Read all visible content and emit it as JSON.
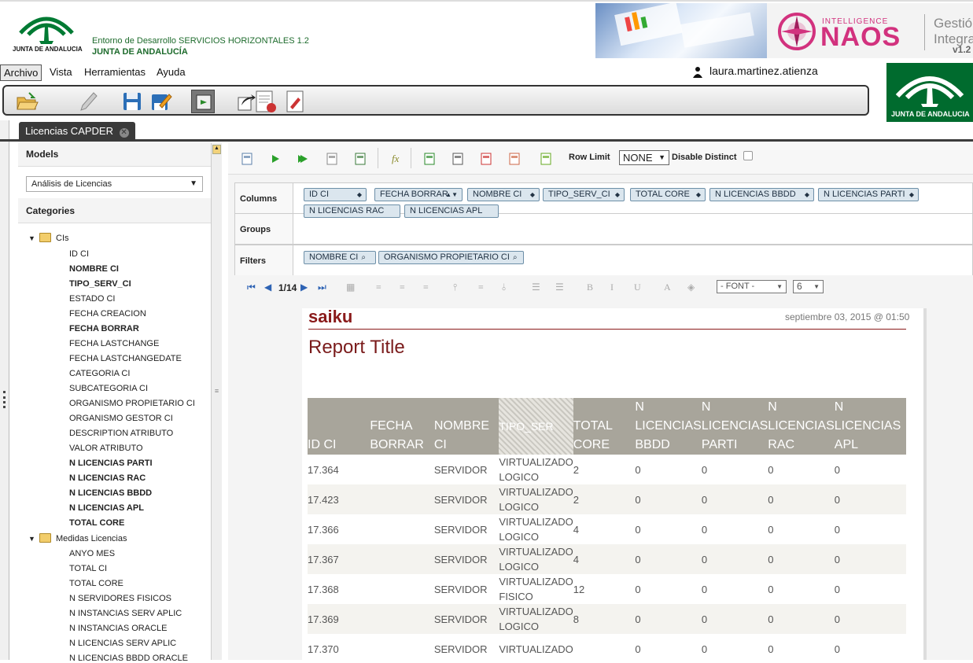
{
  "header": {
    "logo_text": "JUNTA DE ANDALUCIA",
    "env_title": "Entorno de Desarrollo SERVICIOS HORIZONTALES 1.2",
    "org_title": "JUNTA DE ANDALUCÍA",
    "naos_small": "INTELLIGENCE",
    "naos_big": "NAOS",
    "naos_right1": "Gestió",
    "naos_right2": "Integra",
    "naos_version": "v1.2"
  },
  "menu": {
    "archivo": "Archivo",
    "vista": "Vista",
    "herramientas": "Herramientas",
    "ayuda": "Ayuda"
  },
  "user": "laura.martinez.atienza",
  "right_logo_text": "JUNTA DE ANDALUCIA",
  "tab": {
    "label": "Licencias CAPDER"
  },
  "sidebar": {
    "models_title": "Models",
    "model_selected": "Análisis de Licencias",
    "categories_title": "Categories",
    "tree": {
      "group1": "CIs",
      "group1_items": [
        "ID CI",
        "NOMBRE CI",
        "TIPO_SERV_CI",
        "ESTADO CI",
        "FECHA CREACION",
        "FECHA BORRAR",
        "FECHA LASTCHANGE",
        "FECHA LASTCHANGEDATE",
        "CATEGORIA CI",
        "SUBCATEGORIA CI",
        "ORGANISMO PROPIETARIO CI",
        "ORGANISMO GESTOR CI",
        "DESCRIPTION ATRIBUTO",
        "VALOR ATRIBUTO",
        "N LICENCIAS PARTI",
        "N LICENCIAS RAC",
        "N LICENCIAS BBDD",
        "N LICENCIAS APL",
        "TOTAL CORE"
      ],
      "group2": "Medidas Licencias",
      "group2_items": [
        "ANYO MES",
        "TOTAL CI",
        "TOTAL CORE",
        "N SERVIDORES FISICOS",
        "N INSTANCIAS SERV APLIC",
        "N INSTANCIAS ORACLE",
        "N LICENCIAS SERV APLIC",
        "N LICENCIAS BBDD ORACLE"
      ]
    }
  },
  "query_toolbar": {
    "row_limit_label": "Row Limit",
    "row_limit_value": "NONE",
    "disable_distinct": "Disable Distinct"
  },
  "axes": {
    "columns_label": "Columns",
    "columns": [
      "ID CI",
      "FECHA BORRAR",
      "NOMBRE CI",
      "TIPO_SERV_CI",
      "TOTAL CORE",
      "N LICENCIAS BBDD",
      "N LICENCIAS PARTI",
      "N LICENCIAS RAC",
      "N LICENCIAS APL"
    ],
    "groups_label": "Groups",
    "filters_label": "Filters",
    "filters": [
      "NOMBRE CI",
      "ORGANISMO PROPIETARIO CI"
    ]
  },
  "pager": {
    "page": "1/14",
    "font_select": "- FONT -",
    "size_select": "6"
  },
  "report": {
    "logo": "saiku",
    "date": "septiembre 03, 2015 @ 01:50",
    "title": "Report Title",
    "headers": [
      "ID CI",
      "FECHA BORRAR",
      "NOMBRE CI",
      "TIPO_SER",
      "TOTAL CORE",
      "N LICENCIAS BBDD",
      "N LICENCIAS PARTI",
      "N LICENCIAS RAC",
      "N LICENCIAS APL"
    ],
    "rows": [
      [
        "17.364",
        "",
        "SERVIDOR",
        "VIRTUALIZADO LOGICO",
        "2",
        "0",
        "0",
        "0",
        "0"
      ],
      [
        "17.423",
        "",
        "SERVIDOR",
        "VIRTUALIZADO LOGICO",
        "2",
        "0",
        "0",
        "0",
        "0"
      ],
      [
        "17.366",
        "",
        "SERVIDOR",
        "VIRTUALIZADO LOGICO",
        "4",
        "0",
        "0",
        "0",
        "0"
      ],
      [
        "17.367",
        "",
        "SERVIDOR",
        "VIRTUALIZADO LOGICO",
        "4",
        "0",
        "0",
        "0",
        "0"
      ],
      [
        "17.368",
        "",
        "SERVIDOR",
        "VIRTUALIZADO FISICO",
        "12",
        "0",
        "0",
        "0",
        "0"
      ],
      [
        "17.369",
        "",
        "SERVIDOR",
        "VIRTUALIZADO LOGICO",
        "8",
        "0",
        "0",
        "0",
        "0"
      ],
      [
        "17.370",
        "",
        "SERVIDOR",
        "VIRTUALIZADO",
        "",
        "0",
        "0",
        "0",
        "0"
      ]
    ]
  }
}
